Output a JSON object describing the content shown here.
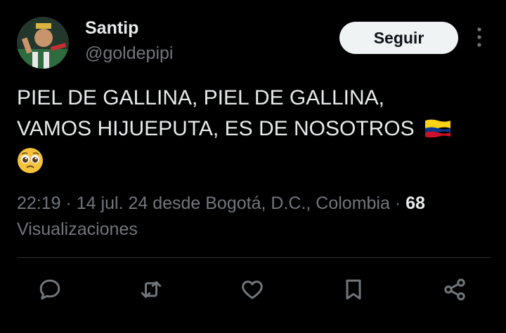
{
  "author": {
    "name": "Santip",
    "handle": "@goldepipi",
    "avatar": "avatar"
  },
  "follow_button": {
    "label": "Seguir"
  },
  "more_icon": "more-vertical-icon",
  "tweet": {
    "line1": "PIEL DE GALLINA, PIEL DE GALLINA,",
    "line2": "VAMOS HIJUEPUTA, ES DE NOSOTROS",
    "flag_emoji": "colombia-flag-icon",
    "emotion_emoji": "pleading-face-icon"
  },
  "meta": {
    "time": "22:19",
    "separator": " · ",
    "date": "14 jul. 24",
    "location_text": " desde Bogotá, D.C., Colombia",
    "views_count": "68",
    "views_label": "Visualizaciones"
  },
  "actions": [
    {
      "name": "reply",
      "icon": "reply-icon"
    },
    {
      "name": "retweet",
      "icon": "retweet-icon"
    },
    {
      "name": "like",
      "icon": "heart-icon"
    },
    {
      "name": "bookmark",
      "icon": "bookmark-icon"
    },
    {
      "name": "share",
      "icon": "share-icon"
    }
  ],
  "colors": {
    "background": "#000000",
    "text": "#e7e9ea",
    "secondary": "#71767b",
    "button_bg": "#eff3f4"
  }
}
